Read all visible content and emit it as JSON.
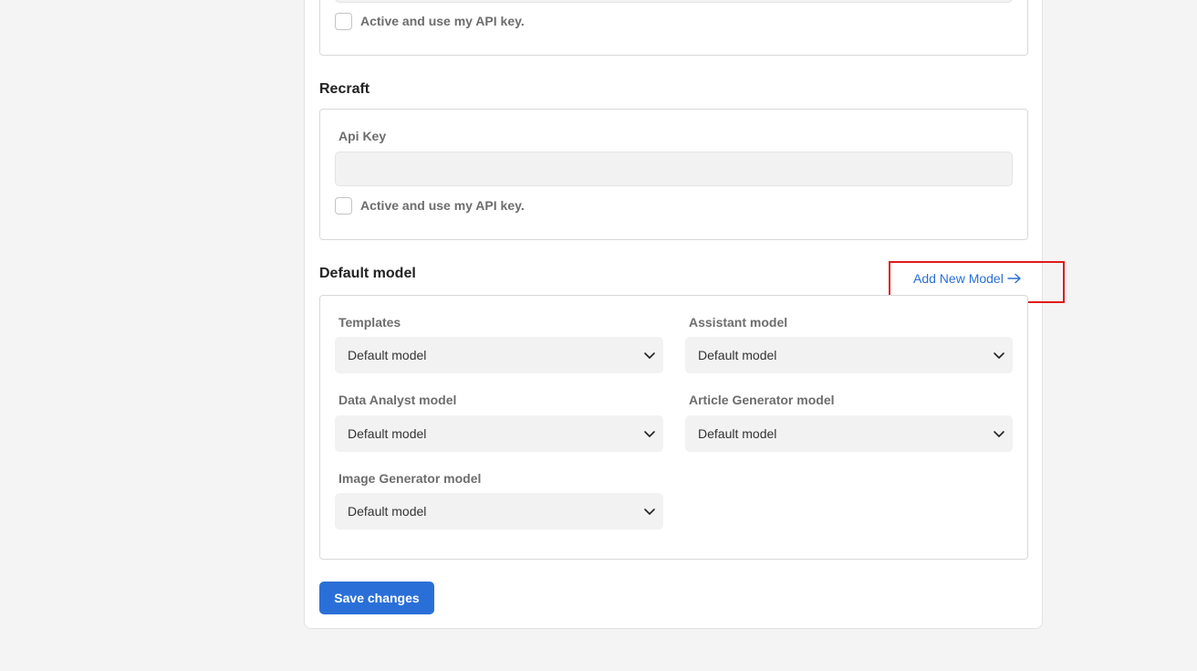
{
  "top_section": {
    "checkbox_label": "Active and use my API key."
  },
  "recraft": {
    "title": "Recraft",
    "api_key_label": "Api Key",
    "api_key_value": "",
    "checkbox_label": "Active and use my API key."
  },
  "default_model": {
    "title": "Default model",
    "add_link": "Add New Model",
    "fields": [
      {
        "label": "Templates",
        "value": "Default model"
      },
      {
        "label": "Assistant model",
        "value": "Default model"
      },
      {
        "label": "Data Analyst model",
        "value": "Default model"
      },
      {
        "label": "Article Generator model",
        "value": "Default model"
      },
      {
        "label": "Image Generator model",
        "value": "Default model"
      }
    ]
  },
  "save_button": "Save changes",
  "colors": {
    "accent": "#2a6fd8",
    "link": "#2a6ed6",
    "highlight": "#e01b1b"
  },
  "icons": {
    "select_arrow": "chevron-down-icon",
    "link_arrow": "arrow-right-icon"
  }
}
